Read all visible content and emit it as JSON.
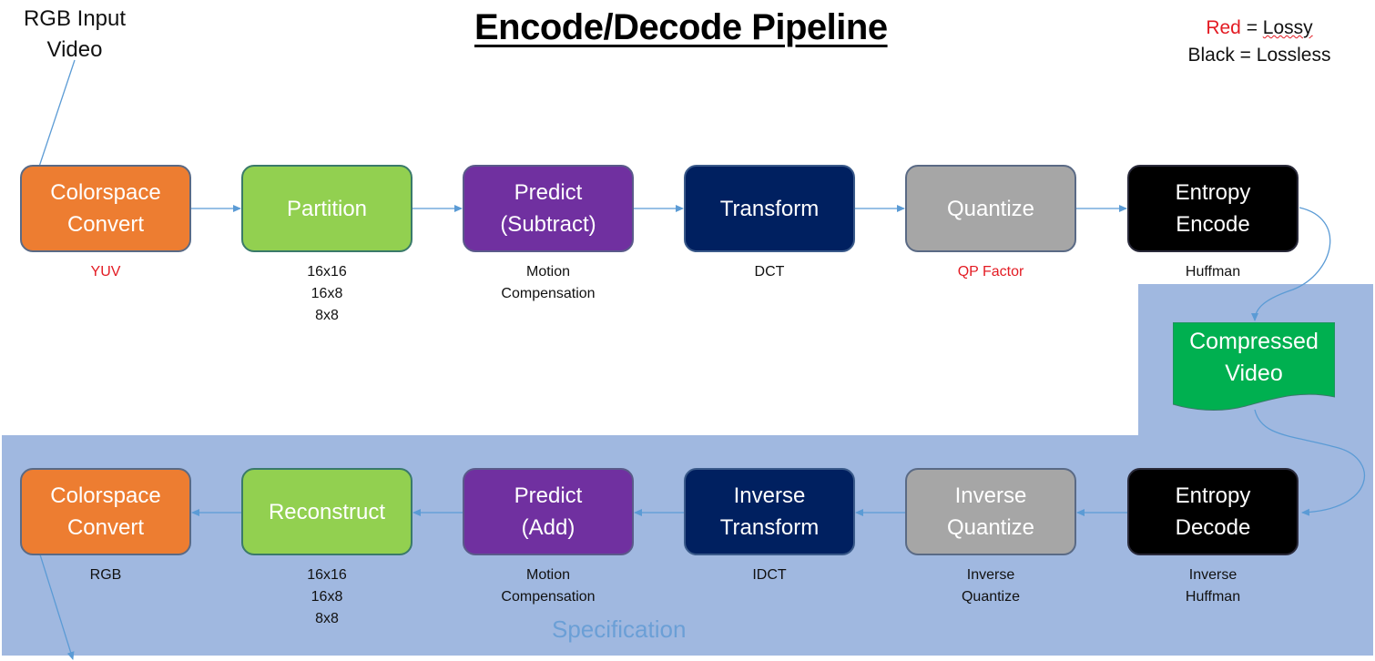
{
  "title": "Encode/Decode Pipeline",
  "legend": {
    "red_word": "Red",
    "eq1": " = ",
    "lossy": "Lossy",
    "line2": "Black = Lossless"
  },
  "input_label": "RGB Input\nVideo",
  "region_label": "Specification",
  "colors": {
    "orange": "#ed7d31",
    "green": "#92d050",
    "purple": "#7030a0",
    "navy": "#002060",
    "gray": "#a6a6a6",
    "black": "#000000",
    "compressed_green": "#00b050",
    "spec_region": "#a0b8e0",
    "arrow": "#5b9bd5",
    "lossy_red": "#e31b23"
  },
  "encode": [
    {
      "label": "Colorspace\nConvert",
      "note": "YUV",
      "lossy": true
    },
    {
      "label": "Partition",
      "note": "16x16\n16x8\n 8x8",
      "lossy": false
    },
    {
      "label": "Predict\n(Subtract)",
      "note": "Motion\nCompensation",
      "lossy": false
    },
    {
      "label": "Transform",
      "note": "DCT",
      "lossy": false
    },
    {
      "label": "Quantize",
      "note": "QP Factor",
      "lossy": true
    },
    {
      "label": "Entropy\nEncode",
      "note": "Huffman",
      "lossy": false
    }
  ],
  "compressed": {
    "label": "Compressed\nVideo"
  },
  "decode": [
    {
      "label": "Colorspace\nConvert",
      "note": "RGB",
      "lossy": false
    },
    {
      "label": "Reconstruct",
      "note": "16x16\n16x8\n 8x8",
      "lossy": false
    },
    {
      "label": "Predict\n(Add)",
      "note": "Motion\nCompensation",
      "lossy": false
    },
    {
      "label": "Inverse\nTransform",
      "note": "IDCT",
      "lossy": false
    },
    {
      "label": "Inverse\nQuantize",
      "note": "Inverse\nQuantize",
      "lossy": false
    },
    {
      "label": "Entropy\nDecode",
      "note": "Inverse\nHuffman",
      "lossy": false
    }
  ]
}
